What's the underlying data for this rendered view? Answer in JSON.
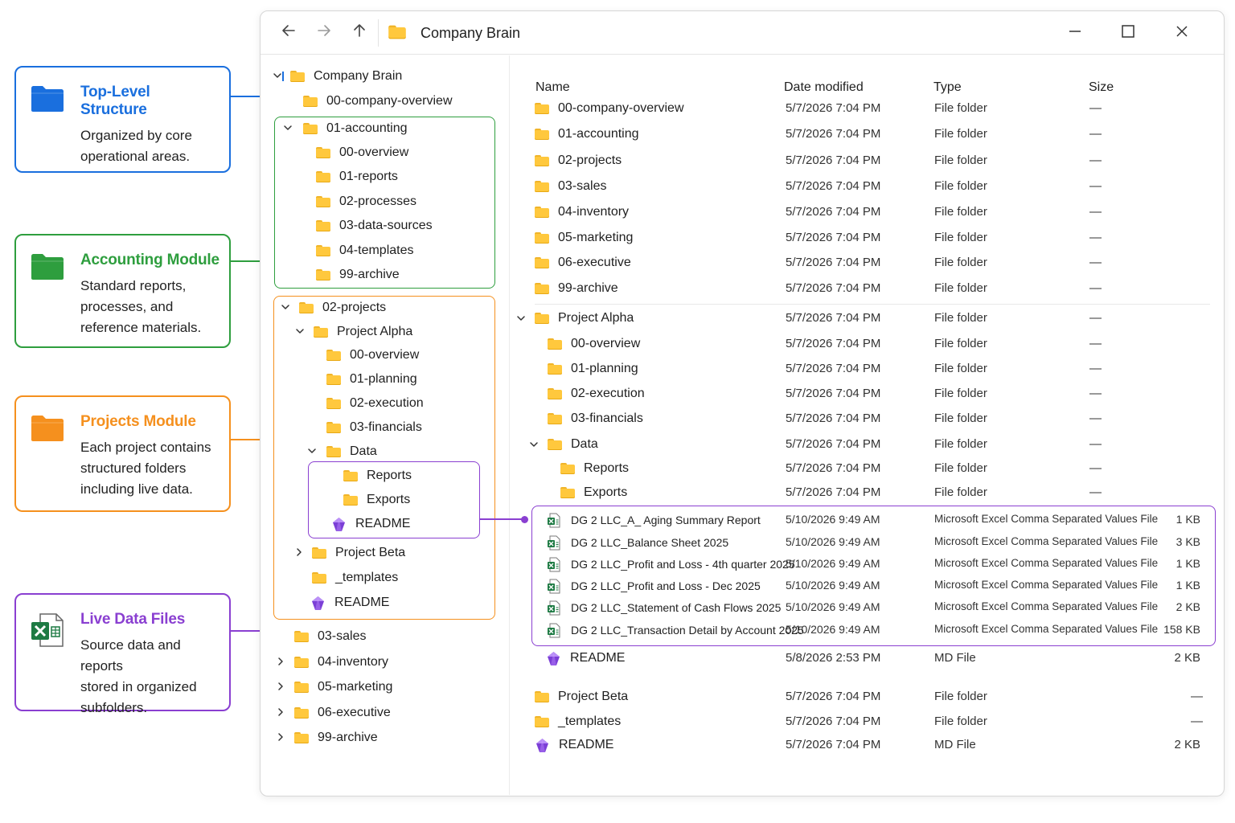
{
  "colors": {
    "blue": "#1a6fde",
    "green": "#2e9e3e",
    "orange": "#f5901e",
    "purple": "#8a3fd1",
    "folder": "#ffc83d"
  },
  "callouts": [
    {
      "title": "Top-Level Structure",
      "desc": [
        "Organized by core",
        "operational areas."
      ],
      "icon": "folder-icon"
    },
    {
      "title": "Accounting Module",
      "desc": [
        "Standard reports,",
        "processes, and",
        "reference materials."
      ],
      "icon": "folder-icon"
    },
    {
      "title": "Projects Module",
      "desc": [
        "Each project contains",
        "structured folders",
        "including live data."
      ],
      "icon": "folder-icon"
    },
    {
      "title": "Live Data Files",
      "desc": [
        "Source data and reports",
        "stored in organized",
        "subfolders."
      ],
      "icon": "excel-icon"
    }
  ],
  "window": {
    "title": "Company Brain",
    "back_icon": "arrow-left-icon",
    "forward_icon": "arrow-right-icon",
    "up_icon": "arrow-up-icon",
    "minimize_icon": "minimize-icon",
    "maximize_icon": "maximize-icon",
    "close_icon": "close-icon"
  },
  "tree": [
    {
      "label": "Company Brain",
      "chev": "down",
      "icon": "folder"
    },
    {
      "label": "00-company-overview",
      "chev": "",
      "icon": "folder"
    },
    {
      "label": "01-accounting",
      "chev": "down",
      "icon": "folder"
    },
    {
      "label": "00-overview",
      "chev": "",
      "icon": "folder"
    },
    {
      "label": "01-reports",
      "chev": "",
      "icon": "folder"
    },
    {
      "label": "02-processes",
      "chev": "",
      "icon": "folder"
    },
    {
      "label": "03-data-sources",
      "chev": "",
      "icon": "folder"
    },
    {
      "label": "04-templates",
      "chev": "",
      "icon": "folder"
    },
    {
      "label": "99-archive",
      "chev": "",
      "icon": "folder"
    },
    {
      "label": "02-projects",
      "chev": "down",
      "icon": "folder"
    },
    {
      "label": "Project Alpha",
      "chev": "down",
      "icon": "folder"
    },
    {
      "label": "00-overview",
      "chev": "",
      "icon": "folder"
    },
    {
      "label": "01-planning",
      "chev": "",
      "icon": "folder"
    },
    {
      "label": "02-execution",
      "chev": "",
      "icon": "folder"
    },
    {
      "label": "03-financials",
      "chev": "",
      "icon": "folder"
    },
    {
      "label": "Data",
      "chev": "down",
      "icon": "folder"
    },
    {
      "label": "Reports",
      "chev": "",
      "icon": "folder"
    },
    {
      "label": "Exports",
      "chev": "",
      "icon": "folder"
    },
    {
      "label": "README",
      "chev": "",
      "icon": "gem"
    },
    {
      "label": "Project Beta",
      "chev": "right",
      "icon": "folder"
    },
    {
      "label": "_templates",
      "chev": "",
      "icon": "folder"
    },
    {
      "label": "README",
      "chev": "",
      "icon": "gem"
    },
    {
      "label": "03-sales",
      "chev": "",
      "icon": "folder"
    },
    {
      "label": "04-inventory",
      "chev": "right",
      "icon": "folder"
    },
    {
      "label": "05-marketing",
      "chev": "right",
      "icon": "folder"
    },
    {
      "label": "06-executive",
      "chev": "right",
      "icon": "folder"
    },
    {
      "label": "99-archive",
      "chev": "right",
      "icon": "folder"
    }
  ],
  "list": {
    "headers": {
      "name": "Name",
      "date": "Date modified",
      "type": "Type",
      "size": "Size"
    },
    "rows": [
      {
        "name": "00-company-overview",
        "date": "5/7/2026 7:04 PM",
        "type": "File folder",
        "size": "—",
        "icon": "folder",
        "chev": ""
      },
      {
        "name": "01-accounting",
        "date": "5/7/2026 7:04 PM",
        "type": "File folder",
        "size": "—",
        "icon": "folder",
        "chev": ""
      },
      {
        "name": "02-projects",
        "date": "5/7/2026 7:04 PM",
        "type": "File folder",
        "size": "—",
        "icon": "folder",
        "chev": ""
      },
      {
        "name": "03-sales",
        "date": "5/7/2026 7:04 PM",
        "type": "File folder",
        "size": "—",
        "icon": "folder",
        "chev": ""
      },
      {
        "name": "04-inventory",
        "date": "5/7/2026 7:04 PM",
        "type": "File folder",
        "size": "—",
        "icon": "folder",
        "chev": ""
      },
      {
        "name": "05-marketing",
        "date": "5/7/2026 7:04 PM",
        "type": "File folder",
        "size": "—",
        "icon": "folder",
        "chev": ""
      },
      {
        "name": "06-executive",
        "date": "5/7/2026 7:04 PM",
        "type": "File folder",
        "size": "—",
        "icon": "folder",
        "chev": ""
      },
      {
        "name": "99-archive",
        "date": "5/7/2026 7:04 PM",
        "type": "File folder",
        "size": "—",
        "icon": "folder",
        "chev": ""
      },
      {
        "name": "Project Alpha",
        "date": "5/7/2026 7:04 PM",
        "type": "File folder",
        "size": "—",
        "icon": "folder",
        "chev": "down"
      },
      {
        "name": "00-overview",
        "date": "5/7/2026 7:04 PM",
        "type": "File folder",
        "size": "—",
        "icon": "folder",
        "chev": ""
      },
      {
        "name": "01-planning",
        "date": "5/7/2026 7:04 PM",
        "type": "File folder",
        "size": "—",
        "icon": "folder",
        "chev": ""
      },
      {
        "name": "02-execution",
        "date": "5/7/2026 7:04 PM",
        "type": "File folder",
        "size": "—",
        "icon": "folder",
        "chev": ""
      },
      {
        "name": "03-financials",
        "date": "5/7/2026 7:04 PM",
        "type": "File folder",
        "size": "—",
        "icon": "folder",
        "chev": ""
      },
      {
        "name": "Data",
        "date": "5/7/2026 7:04 PM",
        "type": "File folder",
        "size": "—",
        "icon": "folder",
        "chev": "down"
      },
      {
        "name": "Reports",
        "date": "5/7/2026 7:04 PM",
        "type": "File folder",
        "size": "—",
        "icon": "folder",
        "chev": ""
      },
      {
        "name": "Exports",
        "date": "5/7/2026 7:04 PM",
        "type": "File folder",
        "size": "—",
        "icon": "folder",
        "chev": ""
      },
      {
        "name": "DG 2 LLC_A_ Aging Summary Report",
        "date": "5/10/2026 9:49 AM",
        "type": "Microsoft Excel Comma Separated Values File",
        "size": "1 KB",
        "icon": "excel",
        "chev": ""
      },
      {
        "name": "DG 2 LLC_Balance Sheet 2025",
        "date": "5/10/2026 9:49 AM",
        "type": "Microsoft Excel Comma Separated Values File",
        "size": "3 KB",
        "icon": "excel",
        "chev": ""
      },
      {
        "name": "DG 2 LLC_Profit and Loss - 4th quarter 2025",
        "date": "5/10/2026 9:49 AM",
        "type": "Microsoft Excel Comma Separated Values File",
        "size": "1 KB",
        "icon": "excel",
        "chev": ""
      },
      {
        "name": "DG 2 LLC_Profit and Loss - Dec 2025",
        "date": "5/10/2026 9:49 AM",
        "type": "Microsoft Excel Comma Separated Values File",
        "size": "1 KB",
        "icon": "excel",
        "chev": ""
      },
      {
        "name": "DG 2 LLC_Statement of Cash Flows 2025",
        "date": "5/10/2026 9:49 AM",
        "type": "Microsoft Excel Comma Separated Values File",
        "size": "2 KB",
        "icon": "excel",
        "chev": ""
      },
      {
        "name": "DG 2 LLC_Transaction Detail by Account 2025",
        "date": "5/10/2026 9:49 AM",
        "type": "Microsoft Excel Comma Separated Values File",
        "size": "158 KB",
        "icon": "excel",
        "chev": ""
      },
      {
        "name": "README",
        "date": "5/8/2026 2:53 PM",
        "type": "MD File",
        "size": "2 KB",
        "icon": "gem",
        "chev": ""
      },
      {
        "name": "Project Beta",
        "date": "5/7/2026 7:04 PM",
        "type": "File folder",
        "size": "—",
        "icon": "folder",
        "chev": ""
      },
      {
        "name": "_templates",
        "date": "5/7/2026 7:04 PM",
        "type": "File folder",
        "size": "—",
        "icon": "folder",
        "chev": ""
      },
      {
        "name": "README",
        "date": "5/7/2026 7:04 PM",
        "type": "MD File",
        "size": "2 KB",
        "icon": "gem",
        "chev": ""
      }
    ]
  }
}
